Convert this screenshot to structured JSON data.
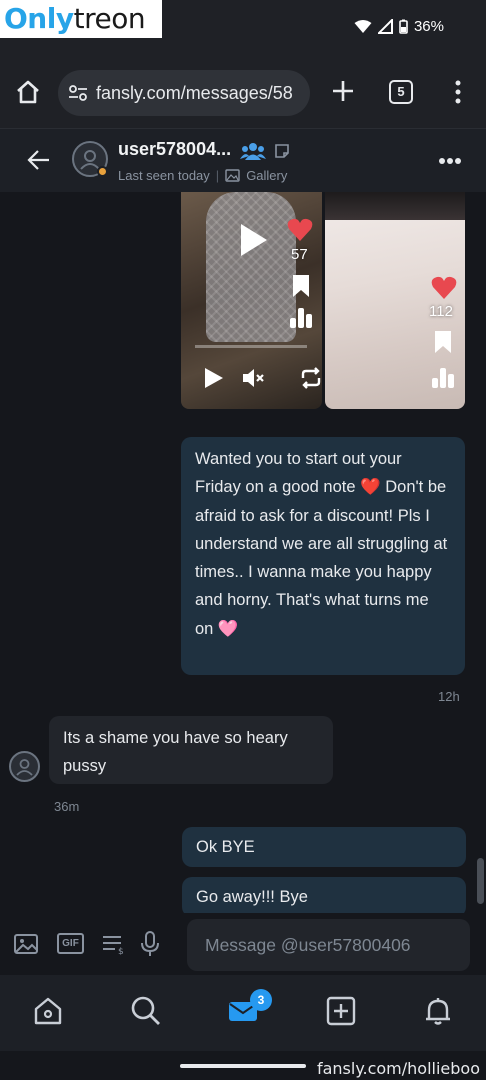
{
  "watermark": {
    "logo_part1": "Only",
    "logo_part2": "treon",
    "bottom_text": "fansly.com/hollieboo"
  },
  "status_bar": {
    "battery": "36%"
  },
  "browser": {
    "url": "fansly.com/messages/58",
    "tabs_count": "5",
    "icons": [
      "home-icon",
      "site-settings-icon",
      "plus-icon",
      "tabs-icon",
      "more-vert-icon"
    ]
  },
  "chat_header": {
    "name": "user578004...",
    "last_seen": "Last seen today",
    "separator": "|",
    "gallery_label": "Gallery"
  },
  "media": [
    {
      "likes": "57",
      "progress": 0
    },
    {
      "likes": "112"
    }
  ],
  "messages": [
    {
      "direction": "outgoing",
      "text": "Wanted you to start out your Friday on a good note ❤️ Don't be afraid to ask for a discount! Pls I understand we are all struggling at times.. I wanna make you happy and horny. That's what turns me on 🩷",
      "time": "12h"
    },
    {
      "direction": "incoming",
      "text": "Its a shame you have so heary pussy",
      "time": "36m"
    },
    {
      "direction": "outgoing",
      "text": "Ok BYE"
    },
    {
      "direction": "outgoing",
      "text": "Go away!!! Bye"
    }
  ],
  "composer": {
    "placeholder": "Message @user57800406",
    "gif_label": "GIF",
    "icons": [
      "image-icon",
      "gif-icon",
      "tip-menu-icon",
      "microphone-icon"
    ]
  },
  "bottom_nav": {
    "items": [
      "home-icon",
      "search-icon",
      "messages-icon",
      "create-post-icon",
      "notifications-icon"
    ],
    "messages_badge": "3",
    "active": "messages",
    "accent": "#2699f0"
  }
}
